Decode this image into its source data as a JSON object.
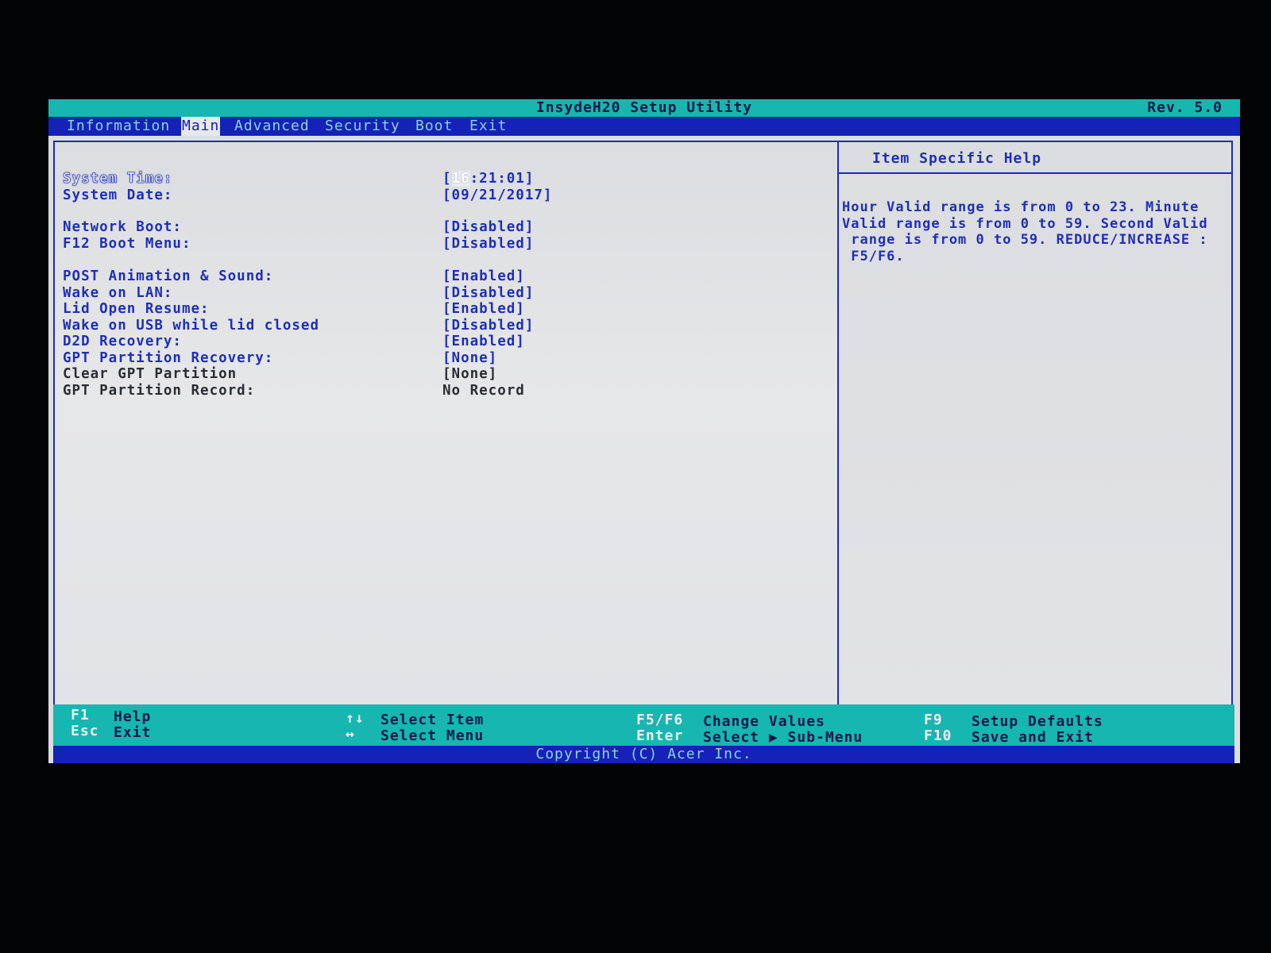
{
  "header": {
    "title": "InsydeH20 Setup Utility",
    "revision": "Rev. 5.0"
  },
  "tabs": [
    {
      "label": "Information"
    },
    {
      "label": "Main"
    },
    {
      "label": "Advanced"
    },
    {
      "label": "Security"
    },
    {
      "label": "Boot"
    },
    {
      "label": "Exit"
    }
  ],
  "active_tab": "Main",
  "settings": [
    {
      "label": "System Time:",
      "value_prefix": "[",
      "value_highlight": "16",
      "value_suffix": ":21:01]"
    },
    {
      "label": "System Date:",
      "value": "[09/21/2017]"
    },
    {
      "label": "Network Boot:",
      "value": "[Disabled]"
    },
    {
      "label": "F12 Boot Menu:",
      "value": "[Disabled]"
    },
    {
      "label": "POST Animation & Sound:",
      "value": "[Enabled]"
    },
    {
      "label": "Wake on LAN:",
      "value": "[Disabled]"
    },
    {
      "label": "Lid Open Resume:",
      "value": "[Enabled]"
    },
    {
      "label": "Wake on USB while lid closed",
      "value": "[Disabled]"
    },
    {
      "label": "D2D Recovery:",
      "value": "[Enabled]"
    },
    {
      "label": "GPT Partition Recovery:",
      "value": "[None]"
    },
    {
      "label": "Clear GPT Partition",
      "value": "[None]"
    },
    {
      "label": "GPT Partition Record:",
      "value": "No Record"
    }
  ],
  "help": {
    "title": "Item Specific Help",
    "text": "Hour Valid range is from 0 to 23. Minute\nValid range is from 0 to 59. Second Valid\n range is from 0 to 59. REDUCE/INCREASE :\n F5/F6."
  },
  "footer": {
    "f1_key": "F1",
    "f1_desc": "Help",
    "esc_key": "Esc",
    "esc_desc": "Exit",
    "updown_key": "↑↓",
    "updown_desc": "Select Item",
    "leftright_key": "↔",
    "leftright_desc": "Select Menu",
    "f5f6_key": "F5/F6",
    "f5f6_desc": "Change Values",
    "enter_key": "Enter",
    "enter_desc": "Select ▶ Sub-Menu",
    "f9_key": "F9",
    "f9_desc": "Setup Defaults",
    "f10_key": "F10",
    "f10_desc": "Save and Exit"
  },
  "copyright": "Copyright (C) Acer Inc.",
  "colors": {
    "menu_blue": "#1422b8",
    "title_cyan": "#17b6b0",
    "text_blue": "#1e2fb8",
    "panel_grey": "#dcdde0"
  }
}
